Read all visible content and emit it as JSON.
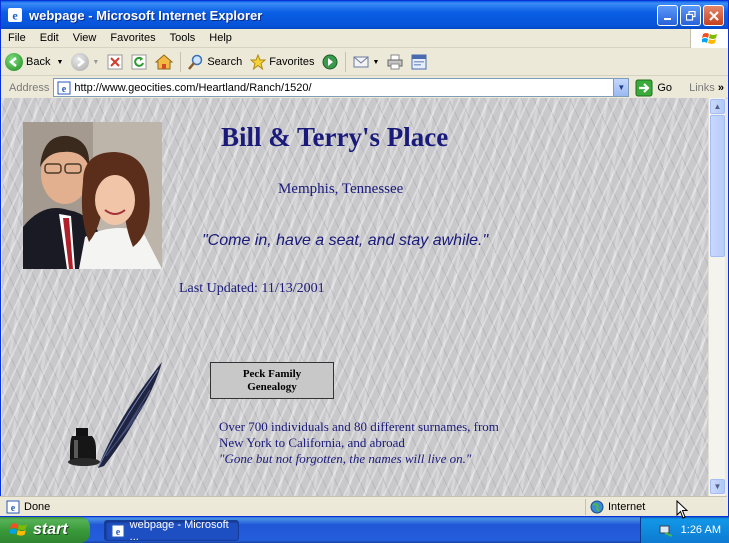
{
  "window": {
    "title": "webpage - Microsoft Internet Explorer"
  },
  "menu": [
    "File",
    "Edit",
    "View",
    "Favorites",
    "Tools",
    "Help"
  ],
  "toolbar": {
    "back": "Back",
    "search": "Search",
    "favorites": "Favorites"
  },
  "address": {
    "label": "Address",
    "url": "http://www.geocities.com/Heartland/Ranch/1520/",
    "go": "Go",
    "links": "Links"
  },
  "page": {
    "title": "Bill & Terry's Place",
    "location": "Memphis, Tennessee",
    "tagline": "\"Come in, have a seat, and stay awhile.\"",
    "updated": "Last Updated: 11/13/2001",
    "genealogy_button_line1": "Peck Family",
    "genealogy_button_line2": "Genealogy",
    "desc_line1": "Over 700 individuals and 80 different surnames, from",
    "desc_line2": "New York to California, and abroad",
    "desc_quote": "\"Gone but not forgotten, the names will live on.\""
  },
  "status": {
    "text": "Done",
    "zone": "Internet"
  },
  "taskbar": {
    "start": "start",
    "task": "webpage - Microsoft ...",
    "clock": "1:26 AM"
  },
  "colors": {
    "heading": "#1a1a7a",
    "titlebar": "#0a5fe4",
    "start": "#3a9b3a"
  }
}
